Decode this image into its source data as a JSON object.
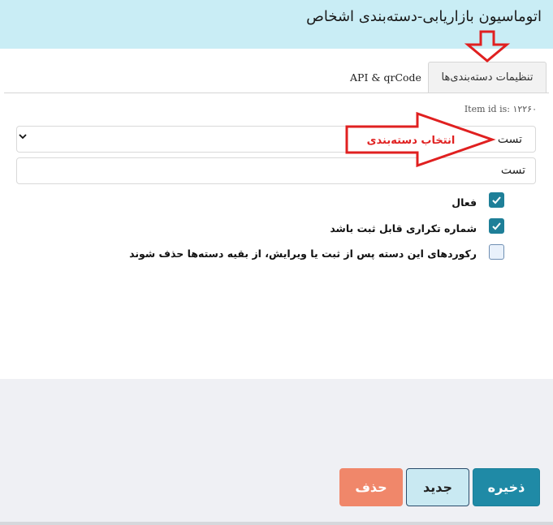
{
  "header": {
    "title": "اتوماسیون بازاریابی-دسته‌بندی اشخاص"
  },
  "tabs": [
    {
      "label": "تنظیمات دسته‌بندی‌ها",
      "active": true
    },
    {
      "label": "API & qrCode",
      "active": false
    }
  ],
  "item_id": "Item id is: ۱۲۲۶۰",
  "form": {
    "category_select": {
      "value": "تست"
    },
    "name_field": {
      "value": "تست"
    },
    "checkboxes": [
      {
        "label": "فعال",
        "checked": true
      },
      {
        "label": "شماره تکراری قابل ثبت باشد",
        "checked": true
      },
      {
        "label": "رکوردهای این دسته پس از ثبت یا ویرایش، از بقیه دسته‌ها حذف شوند",
        "checked": false
      }
    ]
  },
  "annotation": {
    "label": "انتخاب دسته‌بندی",
    "color": "#e02020"
  },
  "buttons": {
    "save": "ذخیره",
    "new": "جدید",
    "delete": "حذف"
  },
  "colors": {
    "header_bg": "#c9edf5",
    "primary": "#1f8aa6",
    "danger": "#f0876a",
    "footer_bg": "#eff0f4"
  }
}
